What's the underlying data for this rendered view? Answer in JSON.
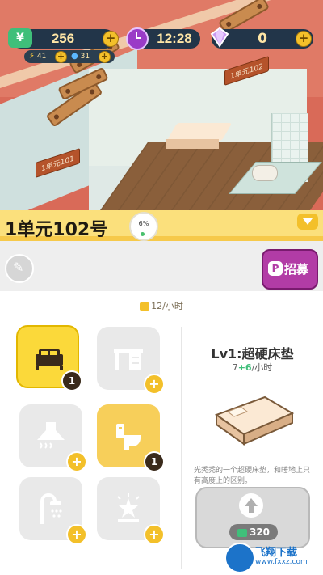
{
  "hud": {
    "money_icon": "¥",
    "money": "256",
    "energy": "41",
    "water": "31",
    "time": "12:28",
    "gems": "0",
    "plus_label": "+"
  },
  "scene": {
    "sign_101": "1单元101",
    "sign_102": "1单元102"
  },
  "header": {
    "unit_title": "1单元102号",
    "progress_text": "6%"
  },
  "recruit": {
    "icon": "P",
    "label": "招募"
  },
  "rate": {
    "text": "12/小时"
  },
  "slots": [
    {
      "name": "bed",
      "state": "active",
      "badge": "1"
    },
    {
      "name": "desk",
      "state": "locked",
      "badge": "+"
    },
    {
      "name": "range-hood",
      "state": "locked",
      "badge": "+"
    },
    {
      "name": "toilet",
      "state": "owned",
      "badge": "1"
    },
    {
      "name": "shower",
      "state": "locked",
      "badge": "+"
    },
    {
      "name": "ceiling-light",
      "state": "locked",
      "badge": "+"
    }
  ],
  "detail": {
    "title": "Lv1:超硬床垫",
    "rate_base": "7",
    "rate_bonus": "+6",
    "rate_unit": "/小时",
    "description": "光秃秃的一个超硬床垫，和睡地上只有高度上的区别。",
    "upgrade_cost": "320"
  },
  "watermark": {
    "text": "飞翔下载",
    "sub": "www.fxxz.com"
  },
  "colors": {
    "accent_yellow": "#fbd93a",
    "recruit_purple": "#b23ca6",
    "money_green": "#3fbf7a"
  }
}
